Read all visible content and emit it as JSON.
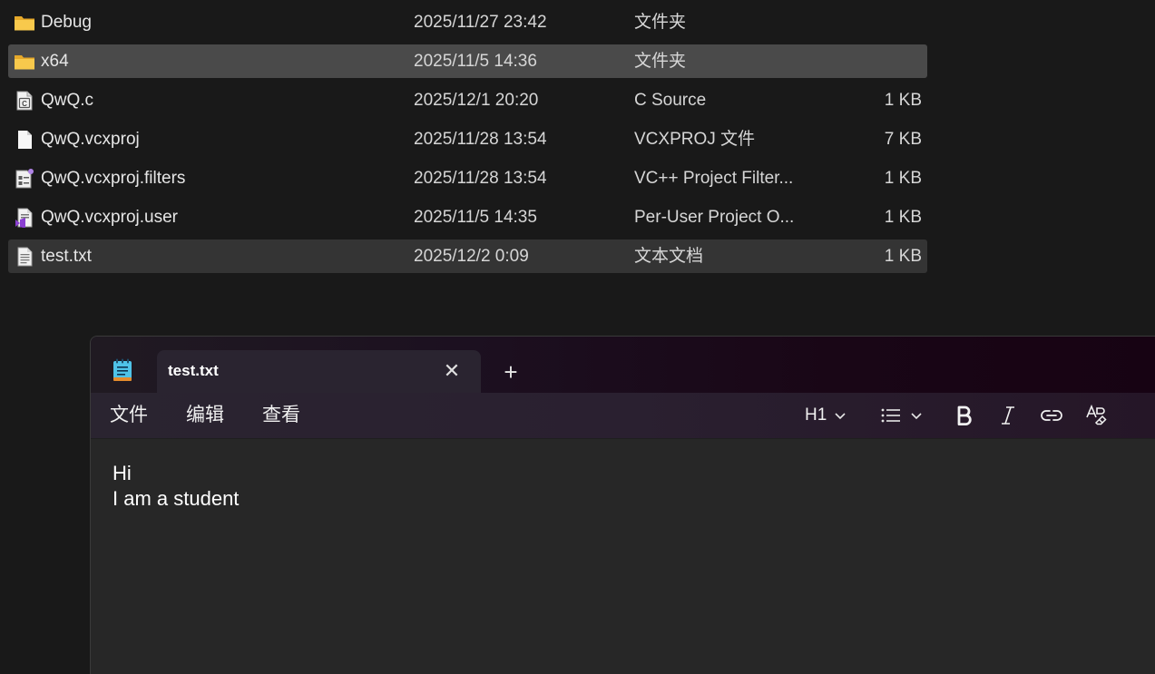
{
  "explorer": {
    "files": [
      {
        "name": "Debug",
        "date": "2025/11/27 23:42",
        "type": "文件夹",
        "size": "",
        "icon": "folder-icon"
      },
      {
        "name": "x64",
        "date": "2025/11/5 14:36",
        "type": "文件夹",
        "size": "",
        "icon": "folder-icon"
      },
      {
        "name": "QwQ.c",
        "date": "2025/12/1 20:20",
        "type": "C Source",
        "size": "1 KB",
        "icon": "c-source-file-icon"
      },
      {
        "name": "QwQ.vcxproj",
        "date": "2025/11/28 13:54",
        "type": "VCXPROJ 文件",
        "size": "7 KB",
        "icon": "generic-file-icon"
      },
      {
        "name": "QwQ.vcxproj.filters",
        "date": "2025/11/28 13:54",
        "type": "VC++ Project Filter...",
        "size": "1 KB",
        "icon": "project-filters-file-icon"
      },
      {
        "name": "QwQ.vcxproj.user",
        "date": "2025/11/5 14:35",
        "type": "Per-User Project O...",
        "size": "1 KB",
        "icon": "visual-studio-file-icon"
      },
      {
        "name": "test.txt",
        "date": "2025/12/2 0:09",
        "type": "文本文档",
        "size": "1 KB",
        "icon": "text-file-icon"
      }
    ]
  },
  "notepad": {
    "tab_title": "test.txt",
    "close_glyph": "✕",
    "new_tab_glyph": "+",
    "menu": {
      "file": "文件",
      "edit": "编辑",
      "view": "查看"
    },
    "toolbar": {
      "heading": "H1"
    },
    "content": {
      "line1": "Hi",
      "line2": "I am a student"
    }
  },
  "colors": {
    "explorer_bg": "#191919",
    "selected_row": "#4a4a4a",
    "hovered_row": "#343434",
    "folder": "#f6c649",
    "editor_bg": "#272727"
  }
}
